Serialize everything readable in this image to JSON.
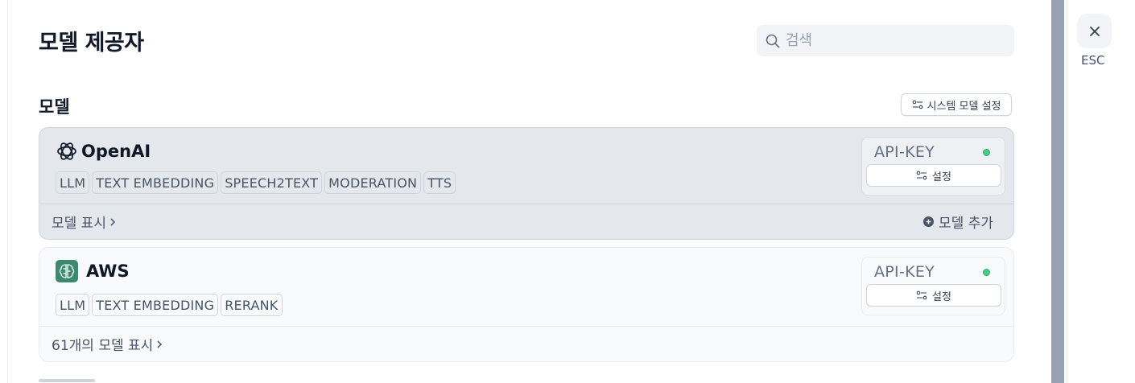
{
  "header": {
    "title": "모델 제공자",
    "search_placeholder": "검색"
  },
  "models_section": {
    "title": "모델",
    "system_settings_label": "시스템 모델 설정"
  },
  "providers": [
    {
      "name": "OpenAI",
      "tags": [
        "LLM",
        "TEXT EMBEDDING",
        "SPEECH2TEXT",
        "MODERATION",
        "TTS"
      ],
      "api_key_label": "API-KEY",
      "status": "active",
      "settings_label": "설정",
      "footer_link": "모델 표시",
      "add_model_label": "모델 추가"
    },
    {
      "name": "AWS",
      "tags": [
        "LLM",
        "TEXT EMBEDDING",
        "RERANK"
      ],
      "api_key_label": "API-KEY",
      "status": "active",
      "settings_label": "설정",
      "footer_link": "61개의 모델 표시"
    }
  ],
  "side": {
    "esc_label": "ESC"
  },
  "colors": {
    "status_active": "#47cd89",
    "aws_brand": "#3a8a6e"
  }
}
